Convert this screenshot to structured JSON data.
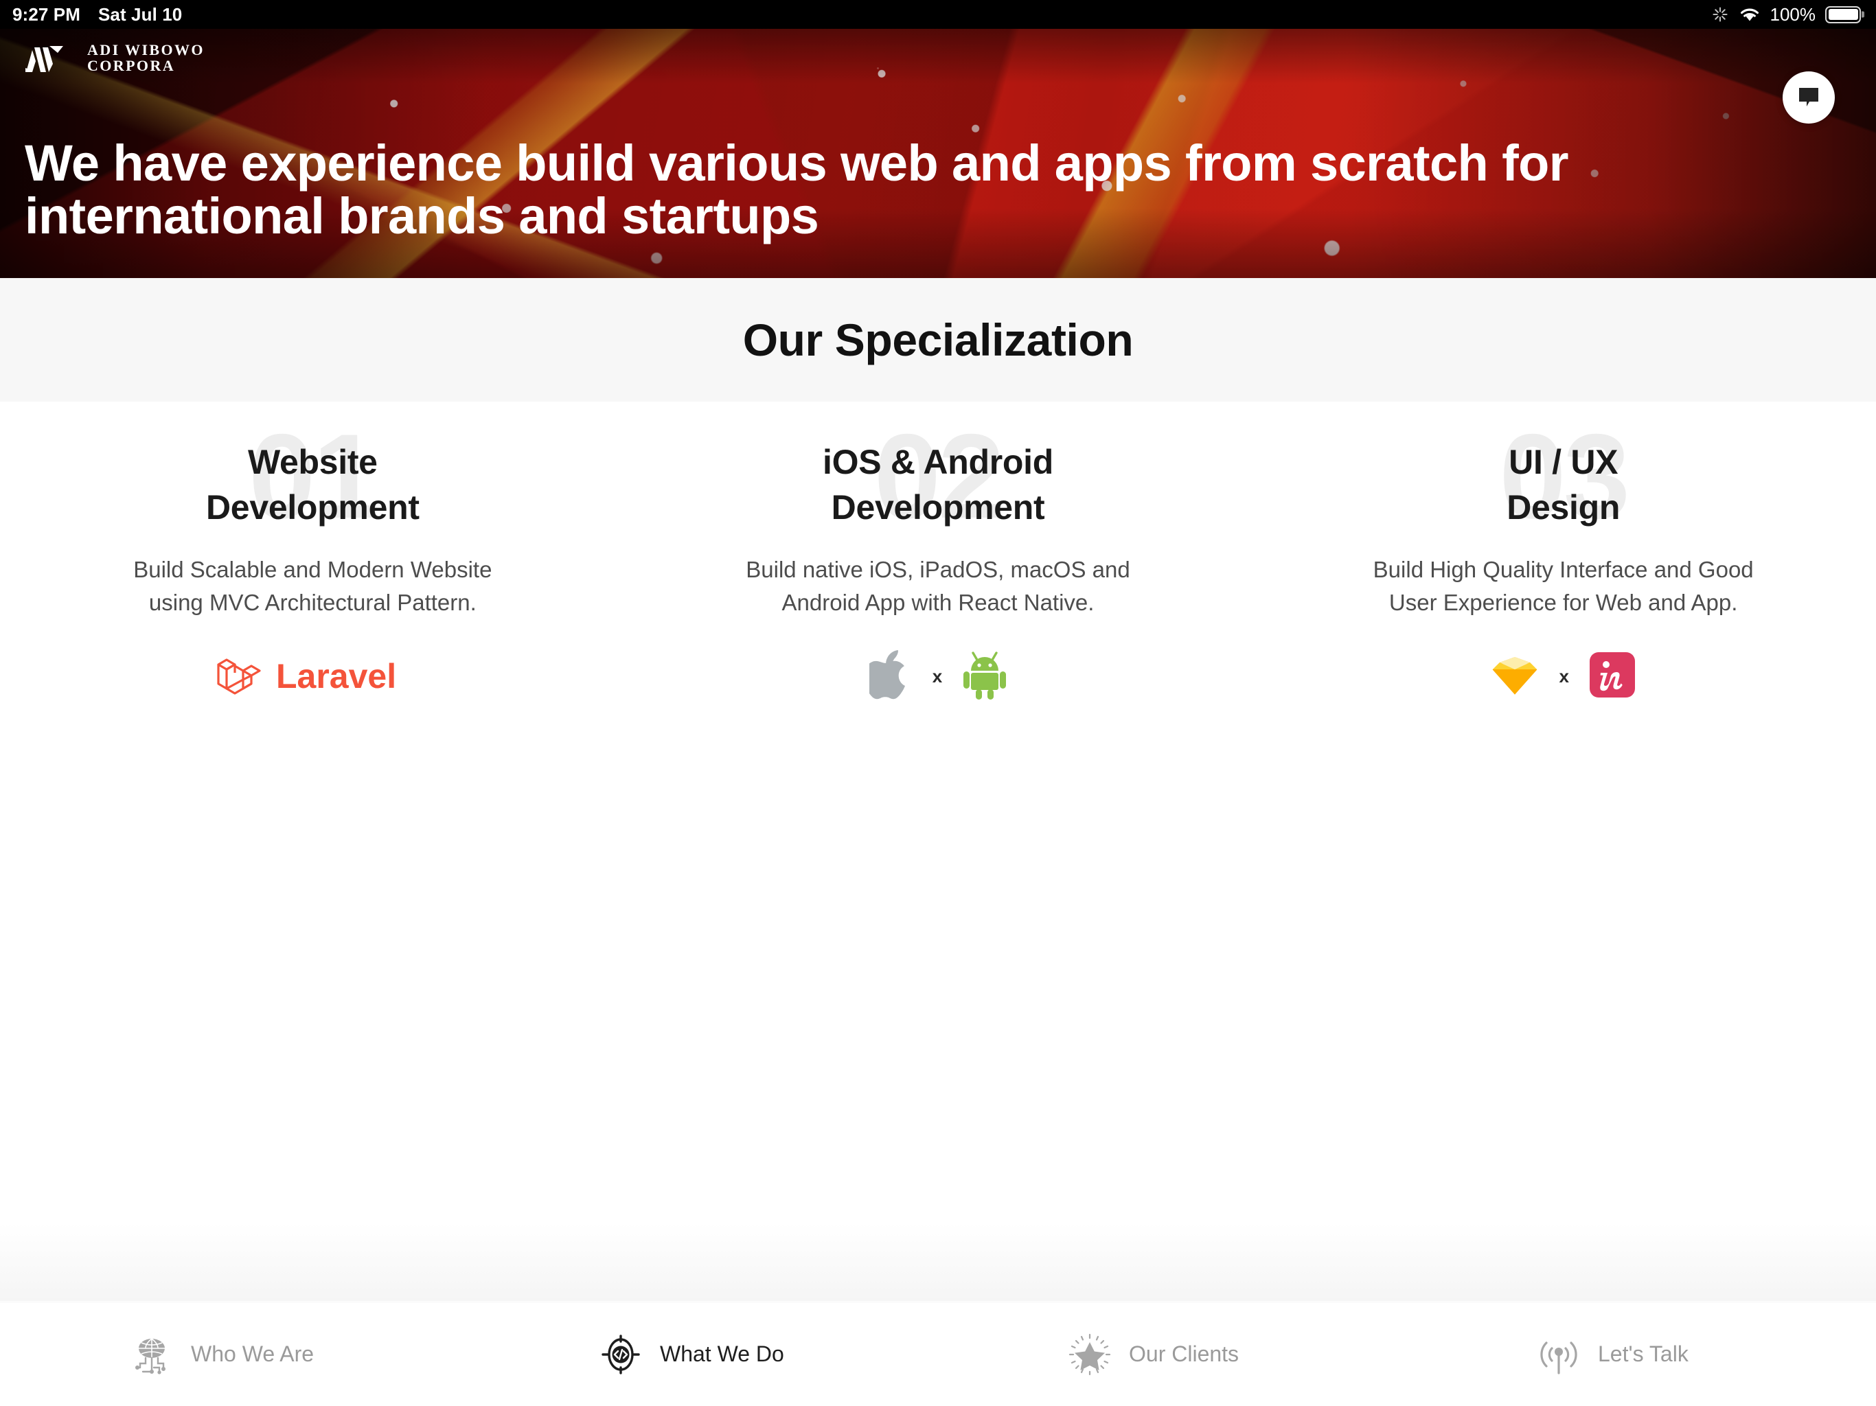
{
  "status_bar": {
    "time": "9:27 PM",
    "date": "Sat Jul 10",
    "battery_percent": "100%",
    "icons": [
      "spinner-icon",
      "wifi-icon",
      "battery-icon"
    ]
  },
  "hero": {
    "logo": {
      "mark": "aw-monogram-icon",
      "line1": "ADI WIBOWO",
      "line2": "CORPORA"
    },
    "chat_button": {
      "icon": "chat-bubble-icon",
      "label": ""
    },
    "headline": "We have experience build various web and apps from scratch for international brands and startups",
    "background": {
      "description": "abstract red crystalline shattered glass texture",
      "base_color": "#c4180f",
      "dark_color": "#120202",
      "accent_color": "#d6aa1e"
    }
  },
  "specialization": {
    "section_title": "Our Specialization",
    "band_color": "#f7f7f7",
    "cards": [
      {
        "number": "01",
        "title_line1": "Website",
        "title_line2": "Development",
        "description_line1": "Build Scalable and Modern Website",
        "description_line2": "using MVC Architectural Pattern.",
        "logos": [
          {
            "name": "laravel-logo",
            "label": "Laravel",
            "color": "#f4533a"
          }
        ],
        "separator": ""
      },
      {
        "number": "02",
        "title_line1": "iOS & Android",
        "title_line2": "Development",
        "description_line1": "Build native iOS, iPadOS, macOS and",
        "description_line2": "Android App with React Native.",
        "logos": [
          {
            "name": "apple-logo",
            "label": "Apple",
            "color": "#aab0b4"
          },
          {
            "name": "android-logo",
            "label": "Android",
            "color": "#8bc34a"
          }
        ],
        "separator": "x"
      },
      {
        "number": "03",
        "title_line1": "UI / UX",
        "title_line2": "Design",
        "description_line1": "Build High Quality Interface and Good",
        "description_line2": "User Experience for Web and App.",
        "logos": [
          {
            "name": "sketch-logo",
            "label": "Sketch",
            "color": "#fdad00"
          },
          {
            "name": "invision-logo",
            "label": "InVision",
            "color": "#dc395f"
          }
        ],
        "separator": "x"
      }
    ]
  },
  "bottom_nav": {
    "items": [
      {
        "label": "Who We Are",
        "icon": "globe-network-icon",
        "active": false
      },
      {
        "label": "What We Do",
        "icon": "code-target-icon",
        "active": true
      },
      {
        "label": "Our Clients",
        "icon": "star-sparkle-icon",
        "active": false
      },
      {
        "label": "Let's Talk",
        "icon": "broadcast-icon",
        "active": false
      }
    ],
    "active_color": "#1e1e1e",
    "inactive_color": "#9a9a9a"
  }
}
